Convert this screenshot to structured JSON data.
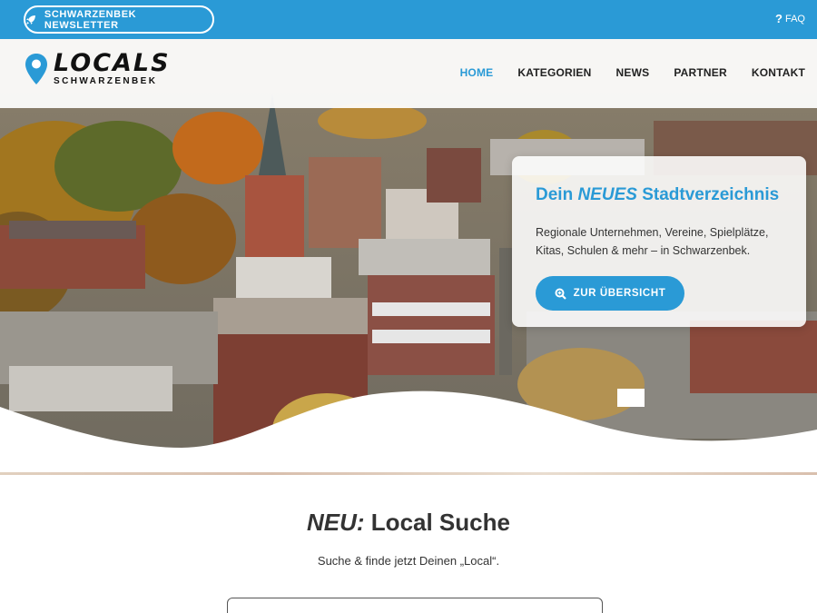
{
  "topbar": {
    "newsletter_label": "SCHWARZENBEK NEWSLETTER",
    "newsletter_icon": "rocket-icon",
    "faq_label": "FAQ",
    "faq_icon": "question-icon"
  },
  "brand": {
    "logo_main": "LOCALS",
    "logo_sub": "SCHWARZENBEK",
    "accent_color": "#2a9ad6"
  },
  "nav": {
    "items": [
      {
        "label": "HOME",
        "active": true
      },
      {
        "label": "KATEGORIEN",
        "active": false
      },
      {
        "label": "NEWS",
        "active": false
      },
      {
        "label": "PARTNER",
        "active": false
      },
      {
        "label": "KONTAKT",
        "active": false
      }
    ]
  },
  "hero": {
    "heading_pre": "Dein ",
    "heading_em": "NEUES",
    "heading_post": " Stadtverzeichnis",
    "text": "Regionale Unternehmen, Vereine, Spielplätze, Kitas, Schulen & mehr – in Schwarzenbek.",
    "cta_label": "ZUR ÜBERSICHT",
    "cta_icon": "search-zoom-icon"
  },
  "search_section": {
    "title_em": "NEU:",
    "title_rest": " Local Suche",
    "subtitle": "Suche & finde jetzt Deinen „Local“.",
    "input_value": ""
  }
}
